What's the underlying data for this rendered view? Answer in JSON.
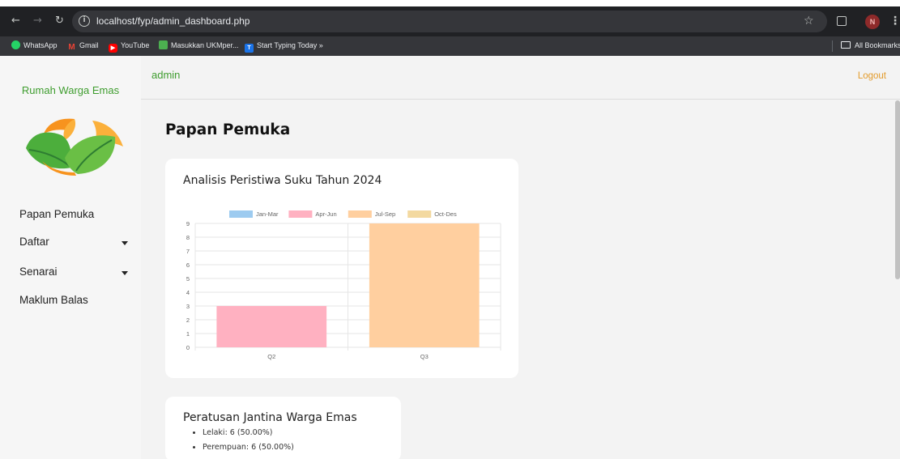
{
  "browser": {
    "url": "localhost/fyp/admin_dashboard.php",
    "profile_initial": "N",
    "bookmarks": [
      {
        "label": "WhatsApp",
        "icon": "whatsapp-icon",
        "color": "#25d366"
      },
      {
        "label": "Gmail",
        "icon": "gmail-icon",
        "color": "#ea4335"
      },
      {
        "label": "YouTube",
        "icon": "youtube-icon",
        "color": "#ff0000"
      },
      {
        "label": "Masukkan UKMper...",
        "icon": "ukm-icon",
        "color": "#4caf50"
      },
      {
        "label": "Start Typing Today »",
        "icon": "typing-icon",
        "color": "#1a73e8"
      }
    ],
    "all_bookmarks": "All Bookmarks"
  },
  "sidebar": {
    "brand": "Rumah Warga Emas",
    "items": [
      {
        "label": "Papan Pemuka",
        "has_caret": false
      },
      {
        "label": "Daftar",
        "has_caret": true
      },
      {
        "label": "Senarai",
        "has_caret": true
      },
      {
        "label": "Maklum Balas",
        "has_caret": false
      }
    ]
  },
  "topbar": {
    "user": "admin",
    "logout": "Logout"
  },
  "page": {
    "title": "Papan Pemuka"
  },
  "event_card": {
    "title": "Analisis Peristiwa Suku Tahun 2024"
  },
  "chart_data": {
    "type": "bar",
    "title": "",
    "categories": [
      "Q2",
      "Q3"
    ],
    "series": [
      {
        "name": "Jan-Mar",
        "color": "#9dcbf0",
        "values": [
          0,
          0
        ]
      },
      {
        "name": "Apr-Jun",
        "color": "#ffb1c1",
        "values": [
          3,
          0
        ]
      },
      {
        "name": "Jul-Sep",
        "color": "#ffcf9f",
        "values": [
          0,
          9
        ]
      },
      {
        "name": "Oct-Des",
        "color": "#f3d9a0",
        "values": [
          0,
          0
        ]
      }
    ],
    "ylim": [
      0,
      9
    ],
    "yticks": [
      "0",
      "1",
      "2",
      "3",
      "4",
      "5",
      "6",
      "7",
      "8",
      "9"
    ],
    "grid": true,
    "legend": "top"
  },
  "gender_card": {
    "title": "Peratusan Jantina Warga Emas",
    "items": [
      "Lelaki: 6 (50.00%)",
      "Perempuan: 6 (50.00%)"
    ]
  }
}
